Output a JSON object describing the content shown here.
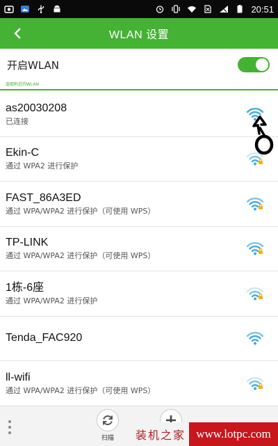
{
  "status_bar": {
    "time": "20:51",
    "left_icons": [
      "screenshot-icon",
      "gallery-icon",
      "usb-icon",
      "android-icon"
    ],
    "right_icons": [
      "alarm-icon",
      "vibrate-icon",
      "wifi-signal-icon",
      "no-sim-icon",
      "cellular-signal-icon",
      "battery-icon"
    ]
  },
  "header": {
    "title": "WLAN 设置",
    "back_icon": "chevron-left-icon",
    "color": "#45b135"
  },
  "wlan_toggle": {
    "label": "开启WLAN",
    "on": true
  },
  "section_header": "选取附近的WLAN",
  "networks": [
    {
      "ssid": "as20030208",
      "subtitle": "已连接",
      "secured": false,
      "connected": true
    },
    {
      "ssid": "Ekin-C",
      "subtitle": "通过 WPA2 进行保护",
      "secured": true
    },
    {
      "ssid": "FAST_86A3ED",
      "subtitle": "通过 WPA/WPA2 进行保护（可使用 WPS）",
      "secured": true
    },
    {
      "ssid": "TP-LINK",
      "subtitle": "通过 WPA/WPA2 进行保护（可使用 WPS）",
      "secured": true
    },
    {
      "ssid": "1栋-6座",
      "subtitle": "通过 WPA/WPA2 进行保护",
      "secured": true
    },
    {
      "ssid": "Tenda_FAC920",
      "subtitle": "",
      "secured": false
    },
    {
      "ssid": "ll-wifi",
      "subtitle": "通过 WPA/WPA2 进行保护（可使用 WPS）",
      "secured": true
    }
  ],
  "bottom_bar": {
    "menu_icon": "more-vertical-icon",
    "scan_label": "扫描",
    "scan_icon": "refresh-icon",
    "add_icon": "plus-icon"
  },
  "watermark": {
    "left_text": "装机之家",
    "right_text": "www.lotpc.com"
  },
  "colors": {
    "accent": "#45b135",
    "wifi_signal": "#47a9de",
    "lock": "#f2b21a",
    "watermark_red": "#c8161d"
  }
}
